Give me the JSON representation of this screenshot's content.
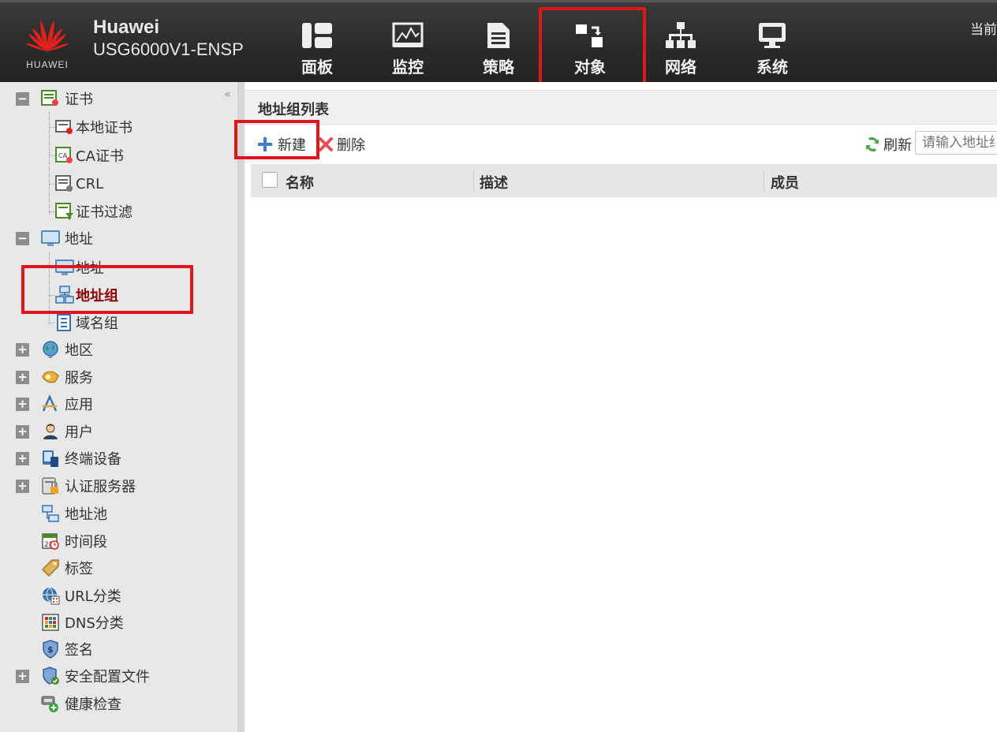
{
  "brand": {
    "logo_text": "HUAWEI",
    "name": "Huawei",
    "model": "USG6000V1-ENSP"
  },
  "nav": [
    {
      "label": "面板",
      "icon": "dashboard-icon"
    },
    {
      "label": "监控",
      "icon": "monitor-icon"
    },
    {
      "label": "策略",
      "icon": "policy-icon"
    },
    {
      "label": "对象",
      "icon": "object-icon"
    },
    {
      "label": "网络",
      "icon": "network-icon"
    },
    {
      "label": "系统",
      "icon": "system-icon"
    }
  ],
  "top_right_text": "当前",
  "sidebar": {
    "items": [
      {
        "label": "证书"
      },
      {
        "label": "本地证书"
      },
      {
        "label": "CA证书"
      },
      {
        "label": "CRL"
      },
      {
        "label": "证书过滤"
      },
      {
        "label": "地址"
      },
      {
        "label": "地址"
      },
      {
        "label": "地址组"
      },
      {
        "label": "域名组"
      },
      {
        "label": "地区"
      },
      {
        "label": "服务"
      },
      {
        "label": "应用"
      },
      {
        "label": "用户"
      },
      {
        "label": "终端设备"
      },
      {
        "label": "认证服务器"
      },
      {
        "label": "地址池"
      },
      {
        "label": "时间段"
      },
      {
        "label": "标签"
      },
      {
        "label": "URL分类"
      },
      {
        "label": "DNS分类"
      },
      {
        "label": "签名"
      },
      {
        "label": "安全配置文件"
      },
      {
        "label": "健康检查"
      }
    ]
  },
  "main": {
    "title": "地址组列表",
    "toolbar": {
      "new_label": "新建",
      "delete_label": "删除",
      "refresh_label": "刷新"
    },
    "search": {
      "placeholder": "请输入地址组"
    },
    "columns": [
      "名称",
      "描述",
      "成员"
    ]
  },
  "colors": {
    "highlight": "#e0161d",
    "topbar": "#2c2c2c",
    "selected_text": "#8b0000"
  }
}
